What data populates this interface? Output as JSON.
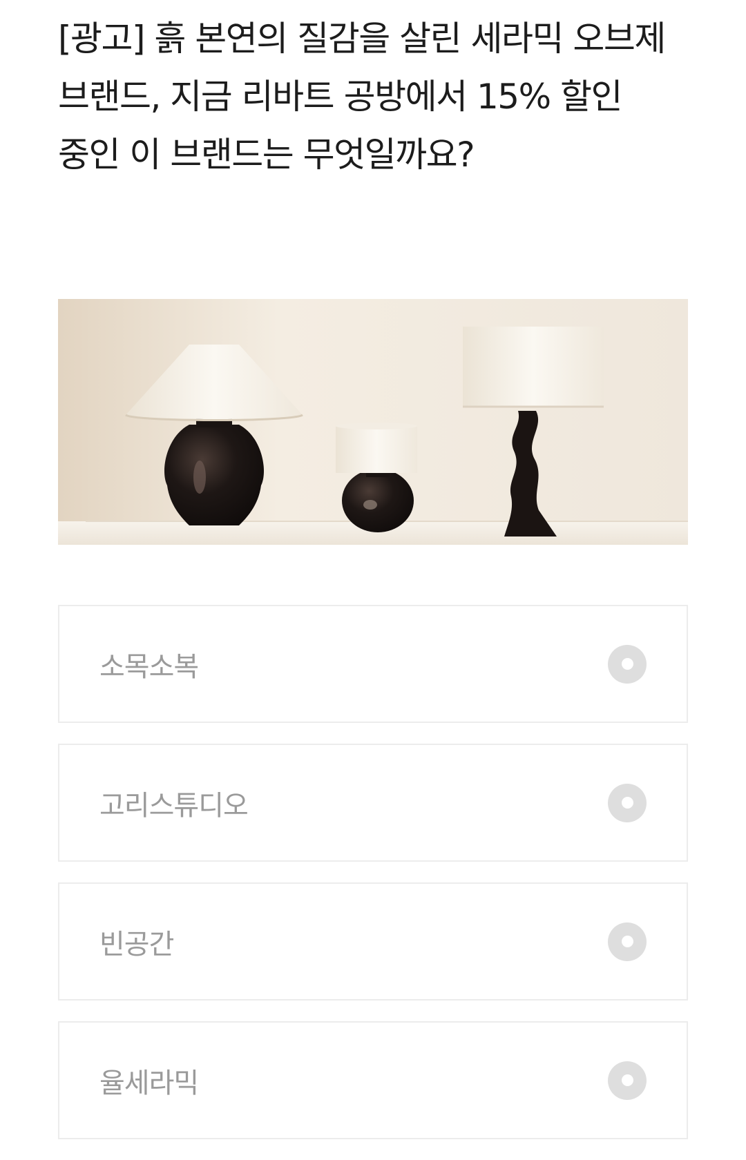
{
  "quiz": {
    "question": "[광고] 흙 본연의 질감을 살린 세라믹 오브제 브랜드, 지금 리바트 공방에서 15% 할인 중인 이 브랜드는 무엇일까요?",
    "image_icon": "ceramic-lamps-photo",
    "options": [
      {
        "label": "소목소복",
        "icon": "radio-icon"
      },
      {
        "label": "고리스튜디오",
        "icon": "radio-icon"
      },
      {
        "label": "빈공간",
        "icon": "radio-icon"
      },
      {
        "label": "율세라믹",
        "icon": "radio-icon"
      }
    ]
  },
  "colors": {
    "text": "#1c1c1c",
    "option_text": "#9a9a9a",
    "option_border": "#ececec",
    "radio": "#dedede"
  }
}
